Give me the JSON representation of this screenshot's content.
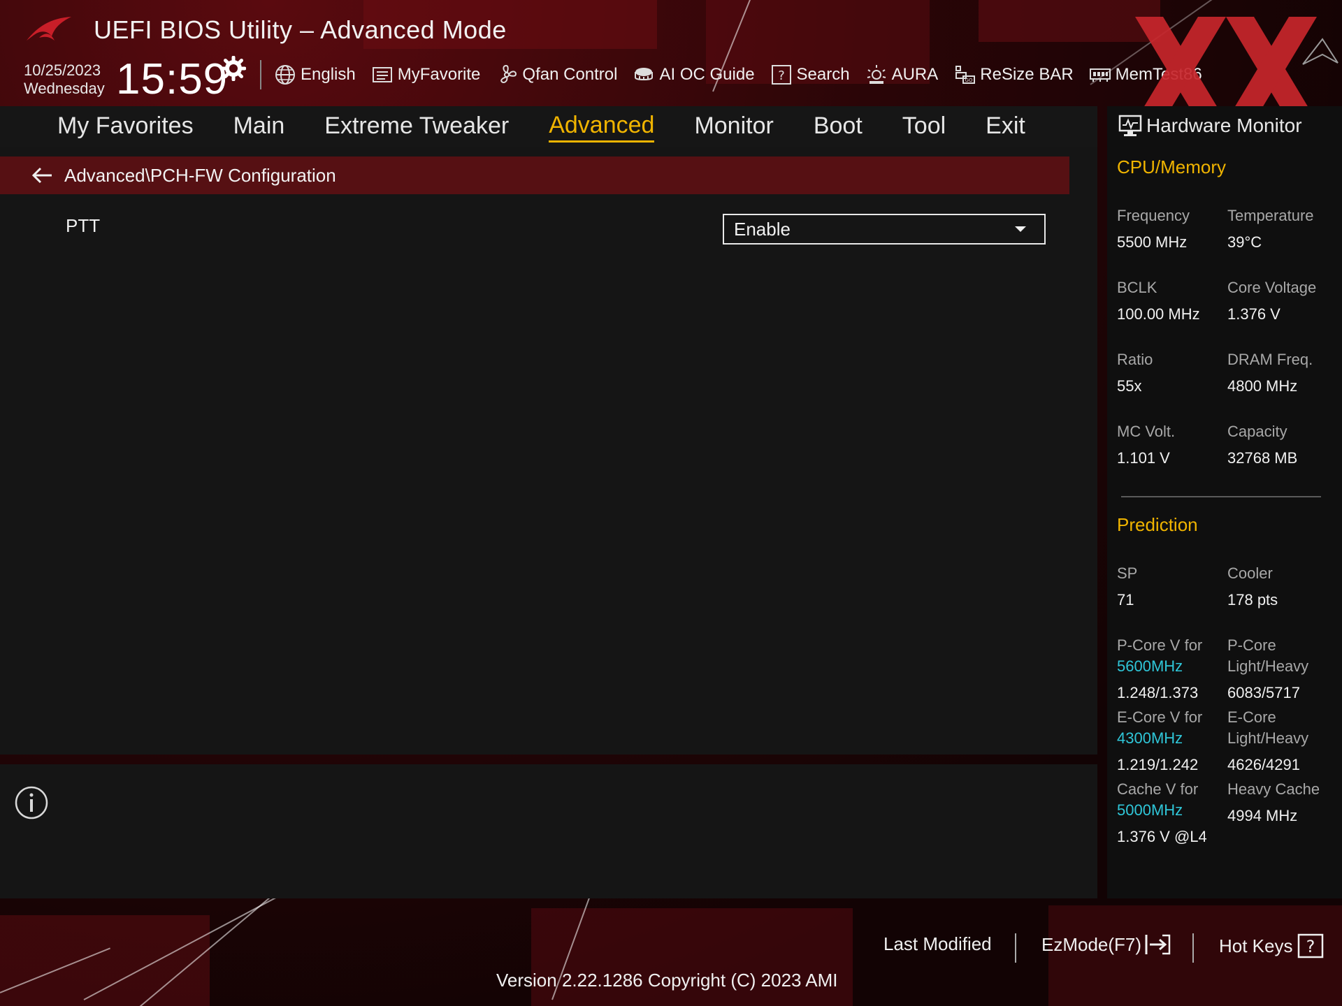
{
  "header": {
    "title": "UEFI BIOS Utility – Advanced Mode",
    "date": "10/25/2023",
    "weekday": "Wednesday",
    "time": "15:59"
  },
  "toolbar": {
    "items": [
      {
        "label": "English",
        "icon": "globe-icon"
      },
      {
        "label": "MyFavorite",
        "icon": "favorite-list-icon"
      },
      {
        "label": "Qfan Control",
        "icon": "fan-icon"
      },
      {
        "label": "AI OC Guide",
        "icon": "ai-chip-icon"
      },
      {
        "label": "Search",
        "icon": "question-box-icon"
      },
      {
        "label": "AURA",
        "icon": "aura-light-icon"
      },
      {
        "label": "ReSize BAR",
        "icon": "resize-bar-icon"
      },
      {
        "label": "MemTest86",
        "icon": "memory-icon"
      }
    ]
  },
  "nav": {
    "tabs": [
      "My Favorites",
      "Main",
      "Extreme Tweaker",
      "Advanced",
      "Monitor",
      "Boot",
      "Tool",
      "Exit"
    ],
    "active": "Advanced"
  },
  "breadcrumb": "Advanced\\PCH-FW Configuration",
  "settings": [
    {
      "label": "PTT",
      "value": "Enable"
    }
  ],
  "hardware_monitor": {
    "title": "Hardware Monitor",
    "cpu_memory": {
      "heading": "CPU/Memory",
      "frequency_label": "Frequency",
      "frequency": "5500 MHz",
      "temperature_label": "Temperature",
      "temperature": "39°C",
      "bclk_label": "BCLK",
      "bclk": "100.00 MHz",
      "core_voltage_label": "Core Voltage",
      "core_voltage": "1.376 V",
      "ratio_label": "Ratio",
      "ratio": "55x",
      "dram_freq_label": "DRAM Freq.",
      "dram_freq": "4800 MHz",
      "mc_volt_label": "MC Volt.",
      "mc_volt": "1.101 V",
      "capacity_label": "Capacity",
      "capacity": "32768 MB"
    },
    "prediction": {
      "heading": "Prediction",
      "sp_label": "SP",
      "sp": "71",
      "cooler_label": "Cooler",
      "cooler": "178 pts",
      "pcore_v_label": "P-Core V for",
      "pcore_v_freq": "5600MHz",
      "pcore_v": "1.248/1.373",
      "pcore_lh_label1": "P-Core",
      "pcore_lh_label2": "Light/Heavy",
      "pcore_lh": "6083/5717",
      "ecore_v_label": "E-Core V for",
      "ecore_v_freq": "4300MHz",
      "ecore_v": "1.219/1.242",
      "ecore_lh_label1": "E-Core",
      "ecore_lh_label2": "Light/Heavy",
      "ecore_lh": "4626/4291",
      "cache_v_label": "Cache V for",
      "cache_v_freq": "5000MHz",
      "cache_v": "1.376 V @L4",
      "heavy_cache_label": "Heavy Cache",
      "heavy_cache": "4994 MHz"
    }
  },
  "footer": {
    "last_modified": "Last Modified",
    "ezmode": "EzMode(F7)",
    "hotkeys": "Hot Keys",
    "version": "Version 2.22.1286 Copyright (C) 2023 AMI"
  },
  "colors": {
    "accent": "#f0b400",
    "breadcrumb_bg": "#561013",
    "cyan": "#2fc6d8"
  }
}
